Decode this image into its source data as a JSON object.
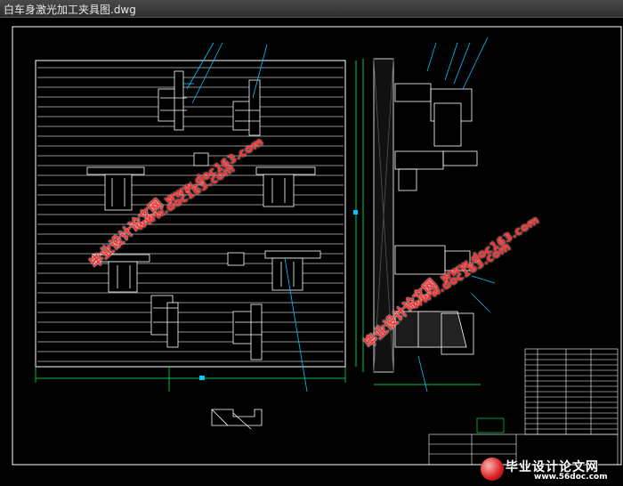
{
  "window": {
    "title": "白车身激光加工夹具图.dwg"
  },
  "watermarks": {
    "cn_1": "毕业设计论文网",
    "url_1": "www.doc163.com",
    "cn_2": "毕业设计论文网",
    "url_2": "www.doc163.com",
    "url_3": "www.doc163.com",
    "url_4": "www.doc163.com"
  },
  "logo": {
    "name": "毕业设计论文网",
    "site": "www.56doc.com"
  },
  "colors": {
    "background": "#000000",
    "lines": "#ffffff",
    "cyan": "#00c8ff",
    "green": "#00ff5a",
    "watermark": "#ff2d2d"
  }
}
